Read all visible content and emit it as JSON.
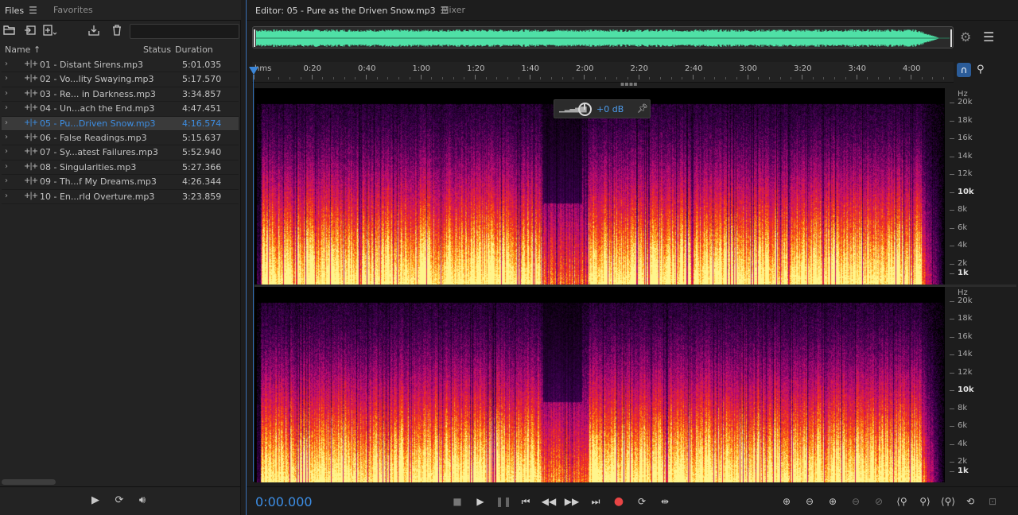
{
  "files_panel": {
    "tab_files": "Files",
    "tab_favorites": "Favorites",
    "search_placeholder": "",
    "columns": {
      "name": "Name",
      "status": "Status",
      "duration": "Duration"
    },
    "files": [
      {
        "name": "01 - Distant Sirens.mp3",
        "duration": "5:01.035",
        "selected": false
      },
      {
        "name": "02 - Vo...lity Swaying.mp3",
        "duration": "5:17.570",
        "selected": false
      },
      {
        "name": "03 - Re... in Darkness.mp3",
        "duration": "3:34.857",
        "selected": false
      },
      {
        "name": "04 - Un...ach the End.mp3",
        "duration": "4:47.451",
        "selected": false
      },
      {
        "name": "05 - Pu...Driven Snow.mp3",
        "duration": "4:16.574",
        "selected": true
      },
      {
        "name": "06 - False Readings.mp3",
        "duration": "5:15.637",
        "selected": false
      },
      {
        "name": "07 - Sy...atest Failures.mp3",
        "duration": "5:52.940",
        "selected": false
      },
      {
        "name": "08 - Singularities.mp3",
        "duration": "5:27.366",
        "selected": false
      },
      {
        "name": "09 - Th...f My Dreams.mp3",
        "duration": "4:26.344",
        "selected": false
      },
      {
        "name": "10 - En...rld Overture.mp3",
        "duration": "3:23.859",
        "selected": false
      }
    ]
  },
  "editor": {
    "tab_editor": "Editor: 05 - Pure as the Driven Snow.mp3",
    "tab_mixer": "Mixer",
    "overview_color": "#4fe0a6",
    "ruler_labels": [
      "hms",
      "0:20",
      "0:40",
      "1:00",
      "1:20",
      "1:40",
      "2:00",
      "2:20",
      "2:40",
      "3:00",
      "3:20",
      "3:40",
      "4:00"
    ],
    "hud_gain": "+0 dB",
    "freq_unit": "Hz",
    "freq_labels": [
      "20k",
      "18k",
      "16k",
      "14k",
      "12k",
      "10k",
      "8k",
      "6k",
      "4k",
      "2k",
      "1k"
    ],
    "timecode": "0:00.000"
  },
  "colors": {
    "accent": "#3c8ee6",
    "record": "#e84545",
    "background": "#1d1d1d"
  }
}
